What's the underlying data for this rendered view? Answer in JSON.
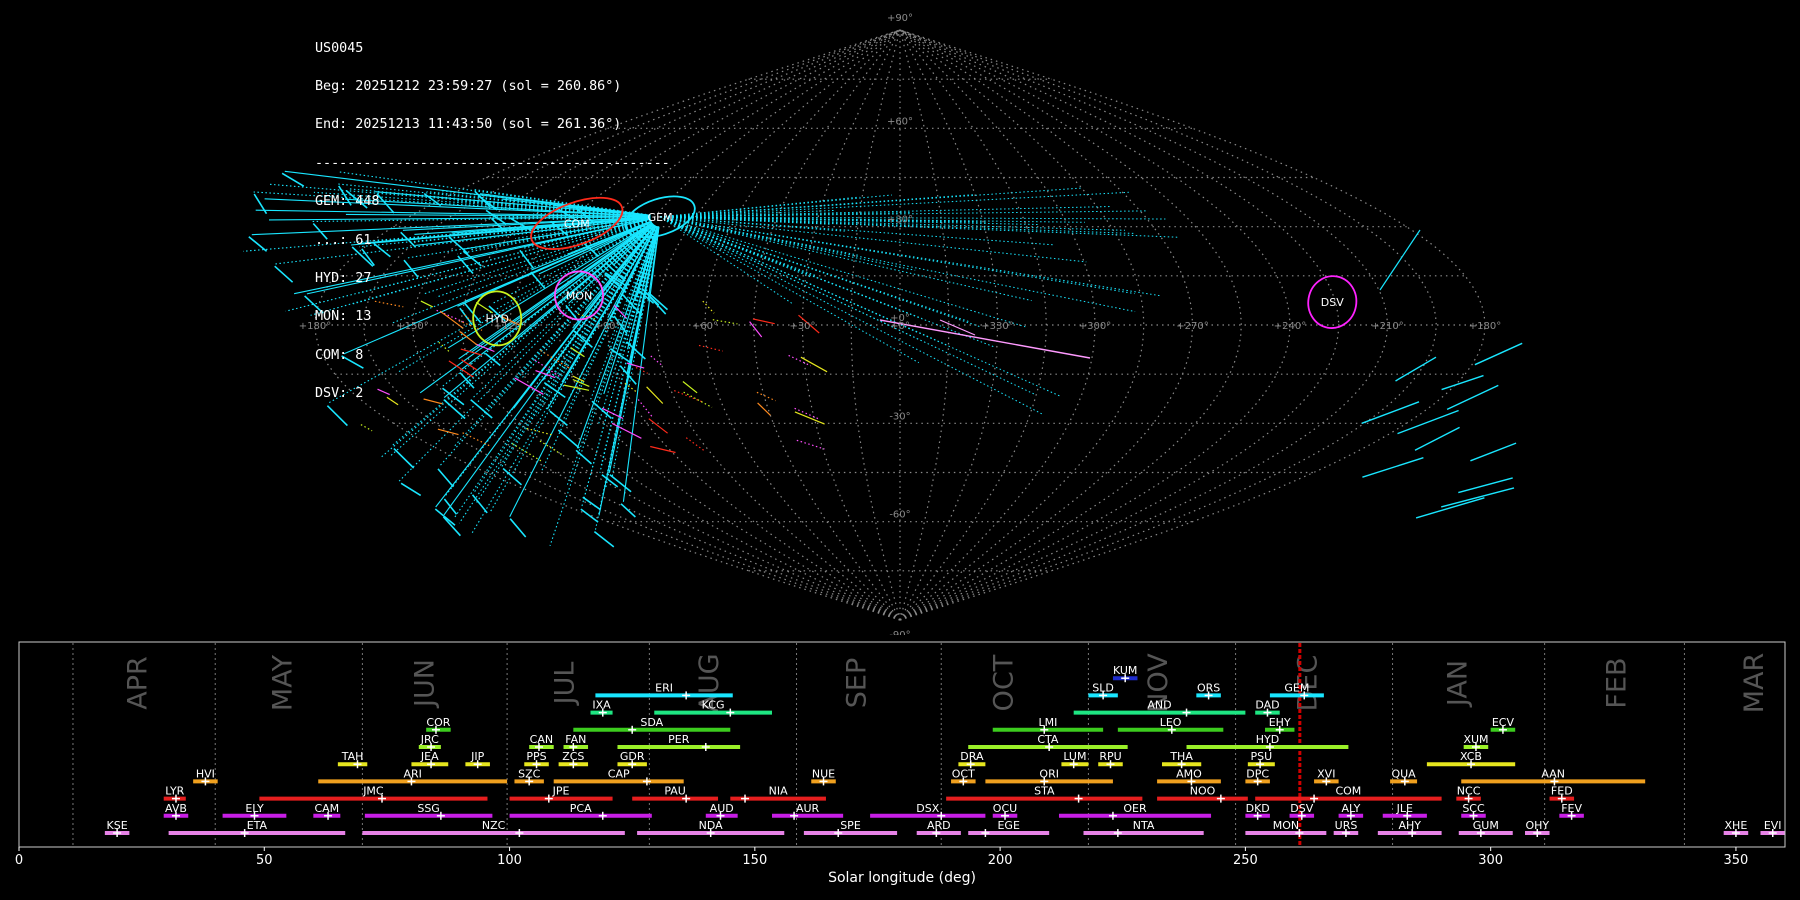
{
  "info": {
    "station": "US0045",
    "beg": "Beg: 20251212 23:59:27 (sol = 260.86°)",
    "end": "End: 20251213 11:43:50 (sol = 261.36°)",
    "separator": "--------------------------------------------",
    "counts": [
      {
        "code": "GEM",
        "text": "GEM: 448"
      },
      {
        "code": "...",
        "text": "...: 61"
      },
      {
        "code": "HYD",
        "text": "HYD: 27"
      },
      {
        "code": "MON",
        "text": "MON: 13"
      },
      {
        "code": "COM",
        "text": "COM: 8"
      },
      {
        "code": "DSV",
        "text": "DSV: 2"
      }
    ]
  },
  "sky_map": {
    "lat_labels": [
      "+90°",
      "+60°",
      "+30°",
      "+0°",
      "-30°",
      "-60°",
      "-90°"
    ],
    "lon_labels": [
      "+180°",
      "+150°",
      "+120°",
      "+90°",
      "+60°",
      "+30°",
      "+0°",
      "+330°",
      "+300°",
      "+270°",
      "+240°",
      "+210°",
      "+180°"
    ],
    "radiants": [
      {
        "code": "COM",
        "lon": 116,
        "lat": 31,
        "color": "#ff2a1a"
      },
      {
        "code": "GEM",
        "lon": 88,
        "lat": 33,
        "color": "#19e6ff"
      },
      {
        "code": "HYD",
        "lon": 124,
        "lat": 2,
        "color": "#c8f21e"
      },
      {
        "code": "MON",
        "lon": 100,
        "lat": 9,
        "color": "#ff4dff"
      },
      {
        "code": "DSV",
        "lon": -134,
        "lat": 7,
        "color": "#ff22ff"
      }
    ]
  },
  "chart_data": {
    "type": "timeline",
    "xlabel": "Solar longitude (deg)",
    "xlim": [
      0,
      360
    ],
    "x_ticks": [
      0,
      50,
      100,
      150,
      200,
      250,
      300,
      350
    ],
    "current_sol": 261.1,
    "months": [
      {
        "name": "APR",
        "start": 11,
        "label": 24.5
      },
      {
        "name": "MAY",
        "start": 40,
        "label": 54
      },
      {
        "name": "JUN",
        "start": 70,
        "label": 83
      },
      {
        "name": "JUL",
        "start": 99.5,
        "label": 111.5
      },
      {
        "name": "AUG",
        "start": 128.5,
        "label": 141
      },
      {
        "name": "SEP",
        "start": 158.5,
        "label": 171
      },
      {
        "name": "OCT",
        "start": 188,
        "label": 201
      },
      {
        "name": "NOV",
        "start": 218,
        "label": 232.5
      },
      {
        "name": "DEC",
        "start": 248,
        "label": 263
      },
      {
        "name": "JAN",
        "start": 280,
        "label": 293.5
      },
      {
        "name": "FEB",
        "start": 311,
        "label": 326
      },
      {
        "name": "MAR",
        "start": 339.5,
        "label": 354
      }
    ],
    "showers": [
      {
        "code": "KUM",
        "start": 223,
        "end": 228,
        "peak": 225.5,
        "row": 10,
        "color": "#1e2ccc"
      },
      {
        "code": "ERI",
        "start": 117.5,
        "end": 145.5,
        "peak": 136,
        "row": 9,
        "color": "#19e6ff"
      },
      {
        "code": "SLD",
        "start": 218,
        "end": 224,
        "peak": 221,
        "row": 9,
        "color": "#19e6ff"
      },
      {
        "code": "ORS",
        "start": 240,
        "end": 245,
        "peak": 242.5,
        "row": 9,
        "color": "#19e6ff"
      },
      {
        "code": "GEM",
        "start": 255,
        "end": 266,
        "peak": 262,
        "row": 9,
        "color": "#19e6ff"
      },
      {
        "code": "IXA",
        "start": 116.5,
        "end": 121,
        "peak": 119,
        "row": 8,
        "color": "#1ee682"
      },
      {
        "code": "KCG",
        "start": 129.5,
        "end": 153.5,
        "peak": 145,
        "row": 8,
        "color": "#1ee682"
      },
      {
        "code": "AND",
        "start": 215,
        "end": 250,
        "peak": 238,
        "row": 8,
        "color": "#1ee682"
      },
      {
        "code": "DAD",
        "start": 252,
        "end": 257,
        "peak": 254.5,
        "row": 8,
        "color": "#1ee682"
      },
      {
        "code": "COR",
        "start": 83,
        "end": 88,
        "peak": 85,
        "row": 7,
        "color": "#3ccc1e"
      },
      {
        "code": "SDA",
        "start": 113,
        "end": 145,
        "peak": 125,
        "row": 7,
        "color": "#3ccc1e"
      },
      {
        "code": "LMI",
        "start": 198.5,
        "end": 221,
        "peak": 209,
        "row": 7,
        "color": "#3ccc1e"
      },
      {
        "code": "LEO",
        "start": 224,
        "end": 245.5,
        "peak": 235,
        "row": 7,
        "color": "#3ccc1e"
      },
      {
        "code": "EHY",
        "start": 254,
        "end": 260,
        "peak": 257,
        "row": 7,
        "color": "#3ccc1e"
      },
      {
        "code": "ECV",
        "start": 300,
        "end": 305,
        "peak": 302.5,
        "row": 7,
        "color": "#3ccc1e"
      },
      {
        "code": "JRC",
        "start": 81.5,
        "end": 86,
        "peak": 84,
        "row": 6,
        "color": "#9bf028"
      },
      {
        "code": "CAN",
        "start": 104,
        "end": 109,
        "peak": 106,
        "row": 6,
        "color": "#9bf028"
      },
      {
        "code": "FAN",
        "start": 111,
        "end": 116,
        "peak": 113,
        "row": 6,
        "color": "#9bf028"
      },
      {
        "code": "PER",
        "start": 122,
        "end": 147,
        "peak": 140,
        "row": 6,
        "color": "#9bf028"
      },
      {
        "code": "CTA",
        "start": 193.5,
        "end": 226,
        "peak": 210,
        "row": 6,
        "color": "#9bf028"
      },
      {
        "code": "HYD",
        "start": 238,
        "end": 271,
        "peak": 255,
        "row": 6,
        "color": "#9bf028"
      },
      {
        "code": "XUM",
        "start": 294.5,
        "end": 299.5,
        "peak": 297,
        "row": 6,
        "color": "#9bf028"
      },
      {
        "code": "TAH",
        "start": 65,
        "end": 71,
        "peak": 69,
        "row": 5,
        "color": "#e6e61e"
      },
      {
        "code": "JEA",
        "start": 80,
        "end": 87.5,
        "peak": 84,
        "row": 5,
        "color": "#e6e61e"
      },
      {
        "code": "JIP",
        "start": 91,
        "end": 96,
        "peak": 93.5,
        "row": 5,
        "color": "#e6e61e"
      },
      {
        "code": "PPS",
        "start": 103,
        "end": 108,
        "peak": 105.5,
        "row": 5,
        "color": "#e6e61e"
      },
      {
        "code": "ZCS",
        "start": 110,
        "end": 116,
        "peak": 113,
        "row": 5,
        "color": "#e6e61e"
      },
      {
        "code": "GDR",
        "start": 122,
        "end": 128,
        "peak": 125,
        "row": 5,
        "color": "#e6e61e"
      },
      {
        "code": "DRA",
        "start": 191.5,
        "end": 197,
        "peak": 194,
        "row": 5,
        "color": "#e6e61e"
      },
      {
        "code": "LUM",
        "start": 212.5,
        "end": 218,
        "peak": 215,
        "row": 5,
        "color": "#e6e61e"
      },
      {
        "code": "RPU",
        "start": 220,
        "end": 225,
        "peak": 222.5,
        "row": 5,
        "color": "#e6e61e"
      },
      {
        "code": "THA",
        "start": 233,
        "end": 241,
        "peak": 237,
        "row": 5,
        "color": "#e6e61e"
      },
      {
        "code": "PSU",
        "start": 250.5,
        "end": 256,
        "peak": 253,
        "row": 5,
        "color": "#e6e61e"
      },
      {
        "code": "XCB",
        "start": 287,
        "end": 305,
        "peak": 296,
        "row": 5,
        "color": "#e6e61e"
      },
      {
        "code": "HVI",
        "start": 35.5,
        "end": 40.5,
        "peak": 38,
        "row": 4,
        "color": "#f0a01e"
      },
      {
        "code": "ARI",
        "start": 61,
        "end": 99.5,
        "peak": 80,
        "row": 4,
        "color": "#f0a01e"
      },
      {
        "code": "SZC",
        "start": 101,
        "end": 107,
        "peak": 104,
        "row": 4,
        "color": "#f0a01e"
      },
      {
        "code": "CAP",
        "start": 109,
        "end": 135.5,
        "peak": 128,
        "row": 4,
        "color": "#f0a01e"
      },
      {
        "code": "NUE",
        "start": 161.5,
        "end": 166.5,
        "peak": 164,
        "row": 4,
        "color": "#f0a01e"
      },
      {
        "code": "OCT",
        "start": 190,
        "end": 195,
        "peak": 192.5,
        "row": 4,
        "color": "#f0a01e"
      },
      {
        "code": "ORI",
        "start": 197,
        "end": 223,
        "peak": 209,
        "row": 4,
        "color": "#f0a01e"
      },
      {
        "code": "AMO",
        "start": 232,
        "end": 245,
        "peak": 239,
        "row": 4,
        "color": "#f0a01e"
      },
      {
        "code": "DPC",
        "start": 250,
        "end": 255,
        "peak": 252.5,
        "row": 4,
        "color": "#f0a01e"
      },
      {
        "code": "XVI",
        "start": 264,
        "end": 269,
        "peak": 266.5,
        "row": 4,
        "color": "#f0a01e"
      },
      {
        "code": "QUA",
        "start": 279.5,
        "end": 285,
        "peak": 282.5,
        "row": 4,
        "color": "#f0a01e"
      },
      {
        "code": "AAN",
        "start": 294,
        "end": 331.5,
        "peak": 313,
        "row": 4,
        "color": "#f0a01e"
      },
      {
        "code": "LYR",
        "start": 29.5,
        "end": 34,
        "peak": 32,
        "row": 3,
        "color": "#e61e1e"
      },
      {
        "code": "JMC",
        "start": 49,
        "end": 95.5,
        "peak": 74,
        "row": 3,
        "color": "#e61e1e"
      },
      {
        "code": "JPE",
        "start": 100,
        "end": 121,
        "peak": 108,
        "row": 3,
        "color": "#e61e1e"
      },
      {
        "code": "PAU",
        "start": 125,
        "end": 142.5,
        "peak": 136,
        "row": 3,
        "color": "#e61e1e"
      },
      {
        "code": "NIA",
        "start": 145,
        "end": 164.5,
        "peak": 148,
        "row": 3,
        "color": "#e61e1e"
      },
      {
        "code": "STA",
        "start": 189,
        "end": 229,
        "peak": 216,
        "row": 3,
        "color": "#e61e1e"
      },
      {
        "code": "NOO",
        "start": 232,
        "end": 250.5,
        "peak": 245,
        "row": 3,
        "color": "#e61e1e"
      },
      {
        "code": "COM",
        "start": 252,
        "end": 290,
        "peak": 264,
        "row": 3,
        "color": "#e61e1e"
      },
      {
        "code": "NCC",
        "start": 293,
        "end": 298,
        "peak": 295.5,
        "row": 3,
        "color": "#e61e1e"
      },
      {
        "code": "FED",
        "start": 312,
        "end": 317,
        "peak": 314.5,
        "row": 3,
        "color": "#e61e1e"
      },
      {
        "code": "AVB",
        "start": 29.5,
        "end": 34.5,
        "peak": 32,
        "row": 2,
        "color": "#c81ee6"
      },
      {
        "code": "ELY",
        "start": 41.5,
        "end": 54.5,
        "peak": 48,
        "row": 2,
        "color": "#c81ee6"
      },
      {
        "code": "CAM",
        "start": 60,
        "end": 65.5,
        "peak": 63,
        "row": 2,
        "color": "#c81ee6"
      },
      {
        "code": "SSG",
        "start": 70.5,
        "end": 96.5,
        "peak": 86,
        "row": 2,
        "color": "#c81ee6"
      },
      {
        "code": "PCA",
        "start": 100,
        "end": 129,
        "peak": 119,
        "row": 2,
        "color": "#c81ee6"
      },
      {
        "code": "AUD",
        "start": 140,
        "end": 146.5,
        "peak": 143,
        "row": 2,
        "color": "#c81ee6"
      },
      {
        "code": "AUR",
        "start": 153.5,
        "end": 168,
        "peak": 158,
        "row": 2,
        "color": "#c81ee6"
      },
      {
        "code": "DSX",
        "start": 173.5,
        "end": 197,
        "peak": 188,
        "row": 2,
        "color": "#c81ee6"
      },
      {
        "code": "OCU",
        "start": 198.5,
        "end": 203.5,
        "peak": 201,
        "row": 2,
        "color": "#c81ee6"
      },
      {
        "code": "OER",
        "start": 212,
        "end": 243,
        "peak": 223,
        "row": 2,
        "color": "#c81ee6"
      },
      {
        "code": "DKD",
        "start": 250,
        "end": 255,
        "peak": 252.5,
        "row": 2,
        "color": "#c81ee6"
      },
      {
        "code": "DSV",
        "start": 259,
        "end": 264,
        "peak": 261.5,
        "row": 2,
        "color": "#c81ee6"
      },
      {
        "code": "ALY",
        "start": 269,
        "end": 274,
        "peak": 271.5,
        "row": 2,
        "color": "#c81ee6"
      },
      {
        "code": "JLE",
        "start": 278,
        "end": 287,
        "peak": 283,
        "row": 2,
        "color": "#c81ee6"
      },
      {
        "code": "SCC",
        "start": 294,
        "end": 299,
        "peak": 296.5,
        "row": 2,
        "color": "#c81ee6"
      },
      {
        "code": "FEV",
        "start": 314,
        "end": 319,
        "peak": 316.5,
        "row": 2,
        "color": "#c81ee6"
      },
      {
        "code": "KSE",
        "start": 17.5,
        "end": 22.5,
        "peak": 20,
        "row": 1,
        "color": "#e682e6"
      },
      {
        "code": "ETA",
        "start": 30.5,
        "end": 66.5,
        "peak": 46,
        "row": 1,
        "color": "#e682e6"
      },
      {
        "code": "NZC",
        "start": 70,
        "end": 123.5,
        "peak": 102,
        "row": 1,
        "color": "#e682e6"
      },
      {
        "code": "NDA",
        "start": 126,
        "end": 156,
        "peak": 141,
        "row": 1,
        "color": "#e682e6"
      },
      {
        "code": "SPE",
        "start": 160,
        "end": 179,
        "peak": 167,
        "row": 1,
        "color": "#e682e6"
      },
      {
        "code": "ARD",
        "start": 183,
        "end": 192,
        "peak": 187,
        "row": 1,
        "color": "#e682e6"
      },
      {
        "code": "EGE",
        "start": 193.5,
        "end": 210,
        "peak": 197,
        "row": 1,
        "color": "#e682e6"
      },
      {
        "code": "NTA",
        "start": 217,
        "end": 241.5,
        "peak": 224,
        "row": 1,
        "color": "#e682e6"
      },
      {
        "code": "MON",
        "start": 250,
        "end": 266.5,
        "peak": 261,
        "row": 1,
        "color": "#e682e6"
      },
      {
        "code": "URS",
        "start": 268,
        "end": 273,
        "peak": 270.5,
        "row": 1,
        "color": "#e682e6"
      },
      {
        "code": "AHY",
        "start": 277,
        "end": 290,
        "peak": 284,
        "row": 1,
        "color": "#e682e6"
      },
      {
        "code": "GUM",
        "start": 293.5,
        "end": 304.5,
        "peak": 298,
        "row": 1,
        "color": "#e682e6"
      },
      {
        "code": "OHY",
        "start": 307,
        "end": 312,
        "peak": 309.5,
        "row": 1,
        "color": "#e682e6"
      },
      {
        "code": "XHE",
        "start": 347.5,
        "end": 352.5,
        "peak": 350,
        "row": 1,
        "color": "#e682e6"
      },
      {
        "code": "EVI",
        "start": 355,
        "end": 360,
        "peak": 357.5,
        "row": 1,
        "color": "#e682e6"
      }
    ]
  }
}
